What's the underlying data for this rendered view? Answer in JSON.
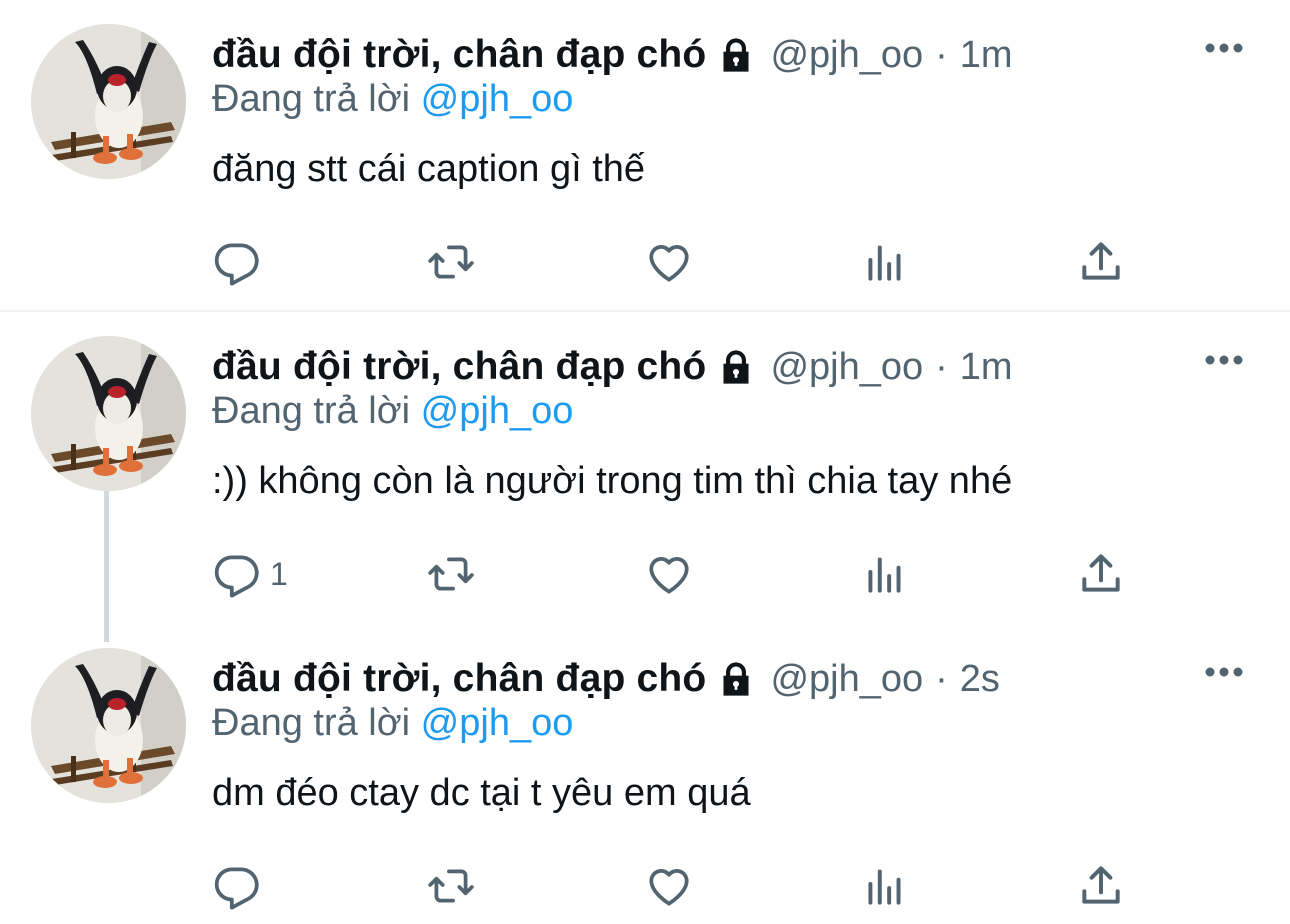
{
  "tweets": [
    {
      "name": "đầu đội trời, chân đạp chó",
      "handle": "@pjh_oo",
      "separator": "·",
      "time": "1m",
      "replying_prefix": "Đang trả lời",
      "replying_to": "@pjh_oo",
      "text": "đăng stt cái caption gì thế",
      "reply_count": ""
    },
    {
      "name": "đầu đội trời, chân đạp chó",
      "handle": "@pjh_oo",
      "separator": "·",
      "time": "1m",
      "replying_prefix": "Đang trả lời",
      "replying_to": "@pjh_oo",
      "text": ":)) không còn là người trong tim thì chia tay nhé",
      "reply_count": "1"
    },
    {
      "name": "đầu đội trời, chân đạp chó",
      "handle": "@pjh_oo",
      "separator": "·",
      "time": "2s",
      "replying_prefix": "Đang trả lời",
      "replying_to": "@pjh_oo",
      "text": "dm đéo ctay dc tại t yêu em quá",
      "reply_count": ""
    }
  ],
  "icons": {
    "reply": "reply-icon",
    "retweet": "retweet-icon",
    "like": "heart-icon",
    "views": "views-icon",
    "share": "share-icon",
    "more": "more-icon",
    "lock": "lock-icon"
  },
  "colors": {
    "text": "#0f1419",
    "secondary": "#536471",
    "link": "#1d9bf0",
    "divider": "#eff3f4"
  }
}
